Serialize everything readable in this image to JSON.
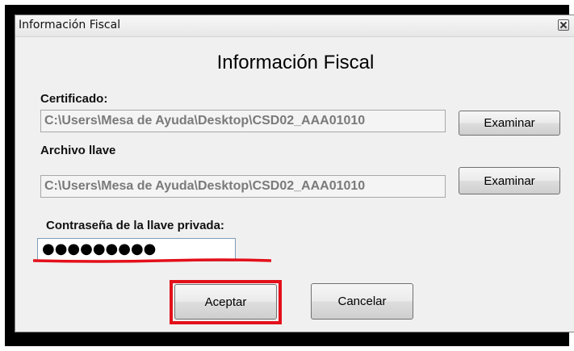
{
  "window": {
    "title": "Información Fiscal",
    "heading": "Información Fiscal"
  },
  "certificado": {
    "label": "Certificado:",
    "path": "C:\\Users\\Mesa de Ayuda\\Desktop\\CSD02_AAA01010",
    "browse_label": "Examinar"
  },
  "llave": {
    "label": "Archivo llave",
    "path": "C:\\Users\\Mesa de Ayuda\\Desktop\\CSD02_AAA01010",
    "browse_label": "Examinar"
  },
  "password": {
    "label": "Contraseña de la llave privada:",
    "masked_value": "●●●●●●●●●"
  },
  "actions": {
    "accept_label": "Aceptar",
    "cancel_label": "Cancelar"
  },
  "annotation_color": "#e3101a"
}
